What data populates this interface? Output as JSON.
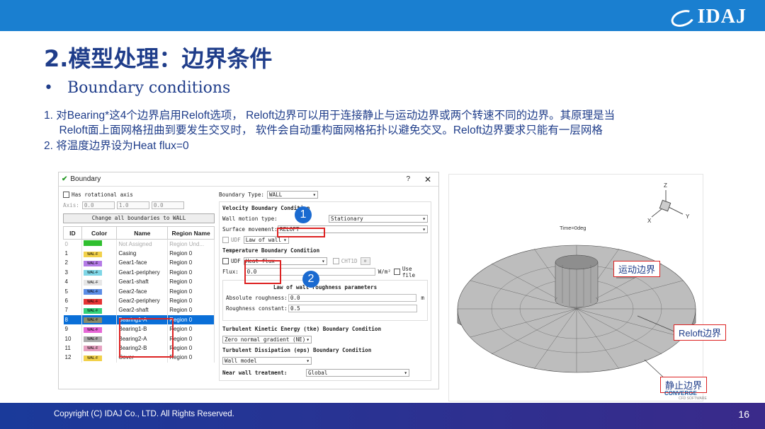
{
  "header": {
    "logo_text": "IDAJ",
    "accent": "#1a7fd0"
  },
  "slide": {
    "title": "2.模型处理：边界条件",
    "bullet": "Boundary conditions",
    "notes": [
      "1.  对Bearing*这4个边界启用Reloft选项， Reloft边界可以用于连接静止与运动边界或两个转速不同的边界。其原理是当",
      "     Reloft面上面网格扭曲到要发生交叉时， 软件会自动重构面网格拓扑以避免交叉。Reloft边界要求只能有一层网格",
      "2.  将温度边界设为Heat flux=0"
    ]
  },
  "footer": {
    "copyright": "Copyright (C)  IDAJ Co., LTD. All Rights Reserved.",
    "page": "16"
  },
  "dialog": {
    "title": "Boundary",
    "help": "?",
    "close": "✕",
    "has_rotational_axis": "Has rotational axis",
    "axis_label": "Axis:",
    "axis_values": [
      "0.0",
      "1.0",
      "0.0"
    ],
    "change_all_button": "Change all boundaries to WALL",
    "columns": [
      "ID",
      "Color",
      "Name",
      "Region Name"
    ],
    "rows": [
      {
        "id": "0",
        "color": "",
        "name": "Not Assigned",
        "region": "Region Und...",
        "swatch": "#2fbf2f",
        "muted": true
      },
      {
        "id": "1",
        "color": "WAL-F",
        "name": "Casing",
        "region": "Region 0",
        "swatch": "#f2d14a"
      },
      {
        "id": "2",
        "color": "WAL-F",
        "name": "Gear1-face",
        "region": "Region 0",
        "swatch": "#b47be6"
      },
      {
        "id": "3",
        "color": "WAL-F",
        "name": "Gear1-periphery",
        "region": "Region 0",
        "swatch": "#7ed6e6"
      },
      {
        "id": "4",
        "color": "WAL-F",
        "name": "Gear1-shaft",
        "region": "Region 0",
        "swatch": "#e6e6e6"
      },
      {
        "id": "5",
        "color": "WAL-F",
        "name": "Gear2-face",
        "region": "Region 0",
        "swatch": "#5b8de6"
      },
      {
        "id": "6",
        "color": "WAL-F",
        "name": "Gear2-periphery",
        "region": "Region 0",
        "swatch": "#e63333"
      },
      {
        "id": "7",
        "color": "WAL-F",
        "name": "Gear2-shaft",
        "region": "Region 0",
        "swatch": "#33d17a"
      },
      {
        "id": "8",
        "color": "WAL-F",
        "name": "Bearing1-A",
        "region": "Region 0",
        "swatch": "#8a8a6a",
        "selected": true
      },
      {
        "id": "9",
        "color": "WAL-F",
        "name": "Bearing1-B",
        "region": "Region 0",
        "swatch": "#e666d6"
      },
      {
        "id": "10",
        "color": "WAL-F",
        "name": "Bearing2-A",
        "region": "Region 0",
        "swatch": "#aaaaaa"
      },
      {
        "id": "11",
        "color": "WAL-F",
        "name": "Bearing2-B",
        "region": "Region 0",
        "swatch": "#e6a0c0"
      },
      {
        "id": "12",
        "color": "WAL-F",
        "name": "Cover",
        "region": "Region 0",
        "swatch": "#f2d14a"
      }
    ],
    "right": {
      "boundary_type_label": "Boundary Type:",
      "boundary_type": "WALL",
      "velocity_header": "Velocity Boundary Condition",
      "wall_motion_label": "Wall motion type:",
      "wall_motion": "Stationary",
      "surface_movement_label": "Surface movement:",
      "surface_movement": "RELOFT",
      "udf": "UDF",
      "law_of_wall": "Law of wall",
      "temperature_header": "Temperature Boundary Condition",
      "heat_flux": "Heat flux",
      "cht1d": "CHT1D",
      "flux_label": "Flux:",
      "flux_value": "0.0",
      "flux_unit": "W/m²",
      "use_file": "Use file",
      "roughness_header": "Law of wall roughness parameters",
      "abs_rough_label": "Absolute roughness:",
      "abs_rough": "0.0",
      "abs_rough_unit": "m",
      "rough_const_label": "Roughness constant:",
      "rough_const": "0.5",
      "tke_header": "Turbulent Kinetic Energy (tke) Boundary Condition",
      "tke_value": "Zero normal gradient (NE)",
      "eps_header": "Turbulent Dissipation (eps) Boundary Condition",
      "eps_value": "Wall model",
      "near_wall_label": "Near wall treatment:",
      "near_wall": "Global"
    },
    "badge1": "1",
    "badge2": "2"
  },
  "view3d": {
    "time": "Time=0deg",
    "axis_z": "Z",
    "axis_x": "X",
    "axis_y": "Y",
    "label_moving": "运动边界",
    "label_reloft": "Reloft边界",
    "label_static": "静止边界",
    "converge": "CONVERGE",
    "converge_sub": "CFD SOFTWARE"
  }
}
